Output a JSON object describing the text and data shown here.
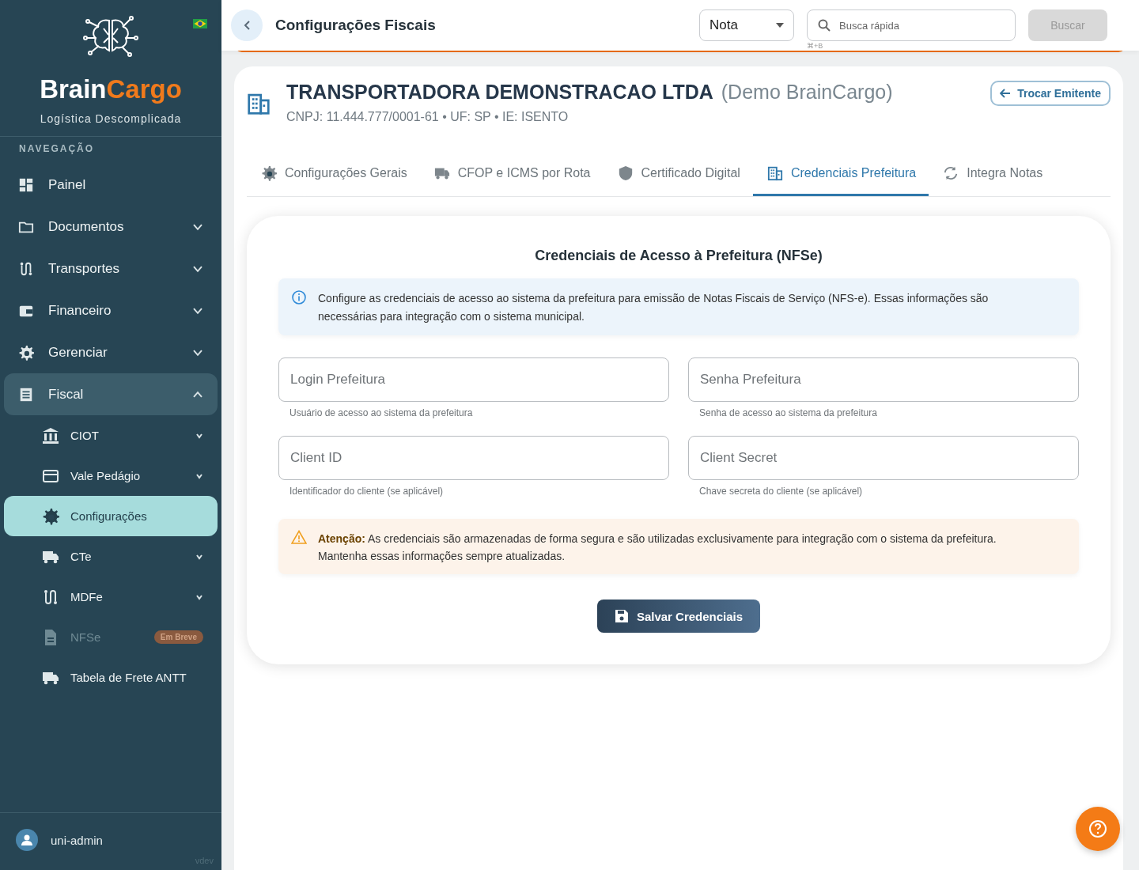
{
  "sidebar": {
    "brand": {
      "part_1": "Brain",
      "part_2": "Cargo"
    },
    "tagline": "Logística Descomplicada",
    "section_label": "NAVEGAÇÃO",
    "items": [
      {
        "label": "Painel",
        "kind": "top",
        "selected": false
      },
      {
        "label": "Documentos",
        "kind": "top",
        "selected": false,
        "expanded": false
      },
      {
        "label": "Transportes",
        "kind": "top",
        "selected": false,
        "expanded": false
      },
      {
        "label": "Financeiro",
        "kind": "top",
        "selected": false,
        "expanded": false
      },
      {
        "label": "Gerenciar",
        "kind": "top",
        "selected": false,
        "expanded": false
      },
      {
        "label": "Fiscal",
        "kind": "top",
        "selected": true,
        "expanded": true
      },
      {
        "label": "CIOT",
        "kind": "sub",
        "selected": false,
        "expanded": false
      },
      {
        "label": "Vale Pedágio",
        "kind": "sub",
        "selected": false,
        "expanded": false
      },
      {
        "label": "Configurações",
        "kind": "sub",
        "selected": true
      },
      {
        "label": "CTe",
        "kind": "sub",
        "selected": false,
        "expanded": false
      },
      {
        "label": "MDFe",
        "kind": "sub",
        "selected": false,
        "expanded": false
      },
      {
        "label": "NFSe",
        "kind": "sub",
        "selected": false,
        "disabled": true,
        "badge": "Em Breve"
      },
      {
        "label": "Tabela de Frete ANTT",
        "kind": "sub",
        "selected": false
      }
    ],
    "user": "uni-admin",
    "version": "vdev"
  },
  "header": {
    "title": "Configurações Fiscais",
    "type_select": "Nota",
    "search": {
      "placeholder": "Busca rápida",
      "shortcut": "⌘+B"
    },
    "search_button": "Buscar"
  },
  "company": {
    "name": "TRANSPORTADORA DEMONSTRACAO LTDA",
    "alias": "(Demo BrainCargo)",
    "details": "CNPJ: 11.444.777/0001-61 • UF: SP • IE: ISENTO",
    "switch_button": "Trocar Emitente"
  },
  "tabs": [
    {
      "label": "Configurações Gerais",
      "selected": false
    },
    {
      "label": "CFOP e ICMS por Rota",
      "selected": false
    },
    {
      "label": "Certificado Digital",
      "selected": false
    },
    {
      "label": "Credenciais Prefeitura",
      "selected": true
    },
    {
      "label": "Integra Notas",
      "selected": false
    }
  ],
  "form": {
    "title": "Credenciais de Acesso à Prefeitura (NFSe)",
    "info": "Configure as credenciais de acesso ao sistema da prefeitura para emissão de Notas Fiscais de Serviço (NFS-e). Essas informações são necessárias para integração com o sistema municipal.",
    "fields": [
      {
        "placeholder": "Login Prefeitura",
        "hint": "Usuário de acesso ao sistema da prefeitura"
      },
      {
        "placeholder": "Senha Prefeitura",
        "hint": "Senha de acesso ao sistema da prefeitura"
      },
      {
        "placeholder": "Client ID",
        "hint": "Identificador do cliente (se aplicável)"
      },
      {
        "placeholder": "Client Secret",
        "hint": "Chave secreta do cliente (se aplicável)"
      }
    ],
    "warning": "**Atenção:** As credenciais são armazenadas de forma segura e são utilizadas exclusivamente para integração com o sistema da prefeitura. Mantenha essas informações sempre atualizadas.",
    "save_button": "Salvar Credenciais"
  }
}
